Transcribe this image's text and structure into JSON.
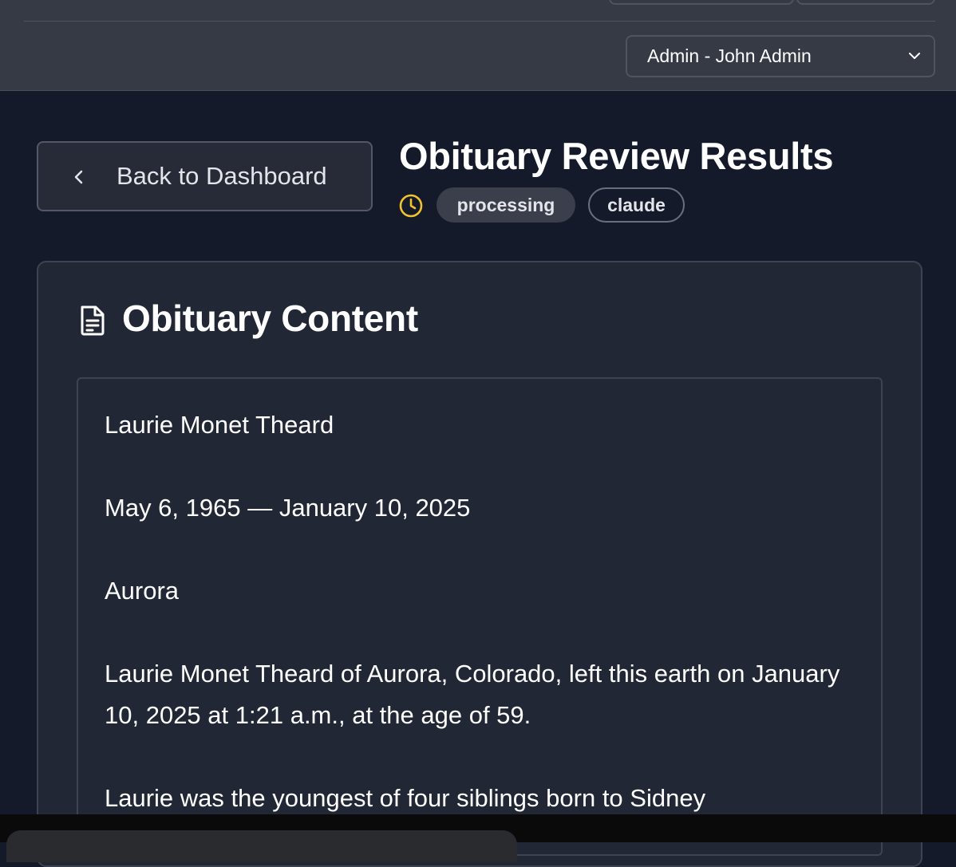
{
  "header": {
    "user_select": {
      "selected": "Admin - John Admin"
    }
  },
  "nav": {
    "back_label": "Back to Dashboard"
  },
  "review": {
    "title": "Obituary Review Results",
    "status": "processing",
    "model": "claude",
    "status_icon": "clock-icon",
    "status_icon_color": "#f1c232"
  },
  "content_card": {
    "title": "Obituary Content",
    "icon": "document-icon",
    "paragraphs": [
      "Laurie Monet Theard",
      "May 6, 1965 — January 10, 2025",
      "Aurora",
      "Laurie Monet Theard of Aurora, Colorado, left this earth on January 10, 2025 at 1:21 a.m., at the age of 59.",
      "Laurie was the youngest of four siblings born to Sidney"
    ]
  }
}
